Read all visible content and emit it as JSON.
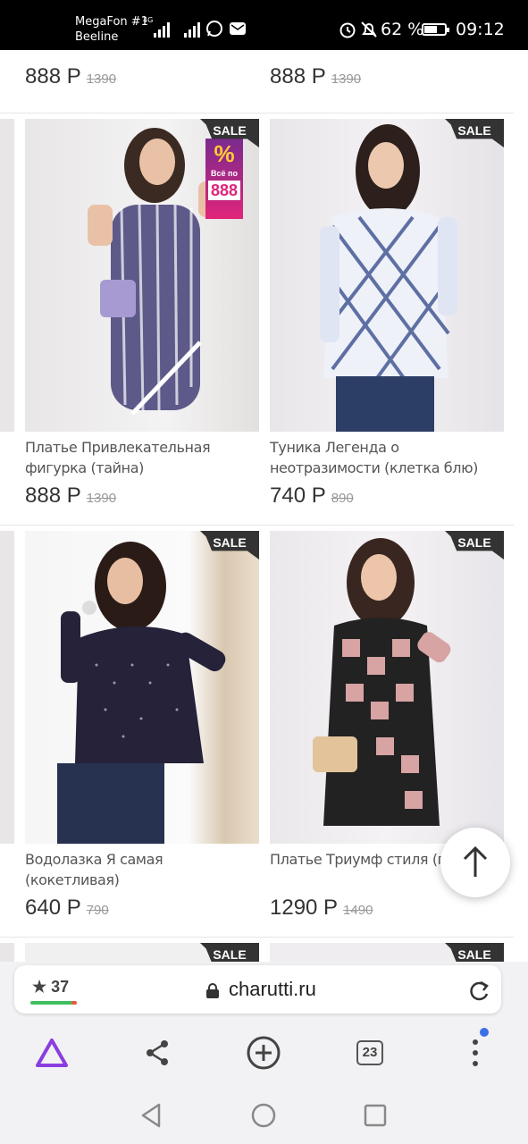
{
  "status_bar": {
    "carrier1": "MegaFon #1",
    "carrier2": "Beeline",
    "net1": "4G",
    "battery": "62 %",
    "time": "09:12"
  },
  "top_prices": [
    {
      "price": "888 Р",
      "old": "1390"
    },
    {
      "price": "888 Р",
      "old": "1390"
    }
  ],
  "products": [
    {
      "name": "Платье Привлекательная фигурка (тайна)",
      "price": "888 Р",
      "old": "1390",
      "sale": "SALE",
      "badge": {
        "pct": "%",
        "vse": "Всё по",
        "num": "888"
      }
    },
    {
      "name": "Туника Легенда о неотразимости (клетка блю)",
      "price": "740 Р",
      "old": "890",
      "sale": "SALE"
    },
    {
      "name": "Водолазка Я самая (кокетливая)",
      "price": "640 Р",
      "old": "790",
      "sale": "SALE"
    },
    {
      "name": "Платье Триумф стиля (пинки)",
      "price": "1290 Р",
      "old": "1490",
      "sale": "SALE"
    }
  ],
  "bottom_sale": [
    "SALE",
    "SALE"
  ],
  "browser": {
    "rating": "37",
    "domain": "charutti.ru",
    "tabs_count": "23"
  },
  "colors": {
    "sale_badge": "#333333",
    "accent_purple": "#8a3ee0",
    "status_bg": "#000000"
  }
}
